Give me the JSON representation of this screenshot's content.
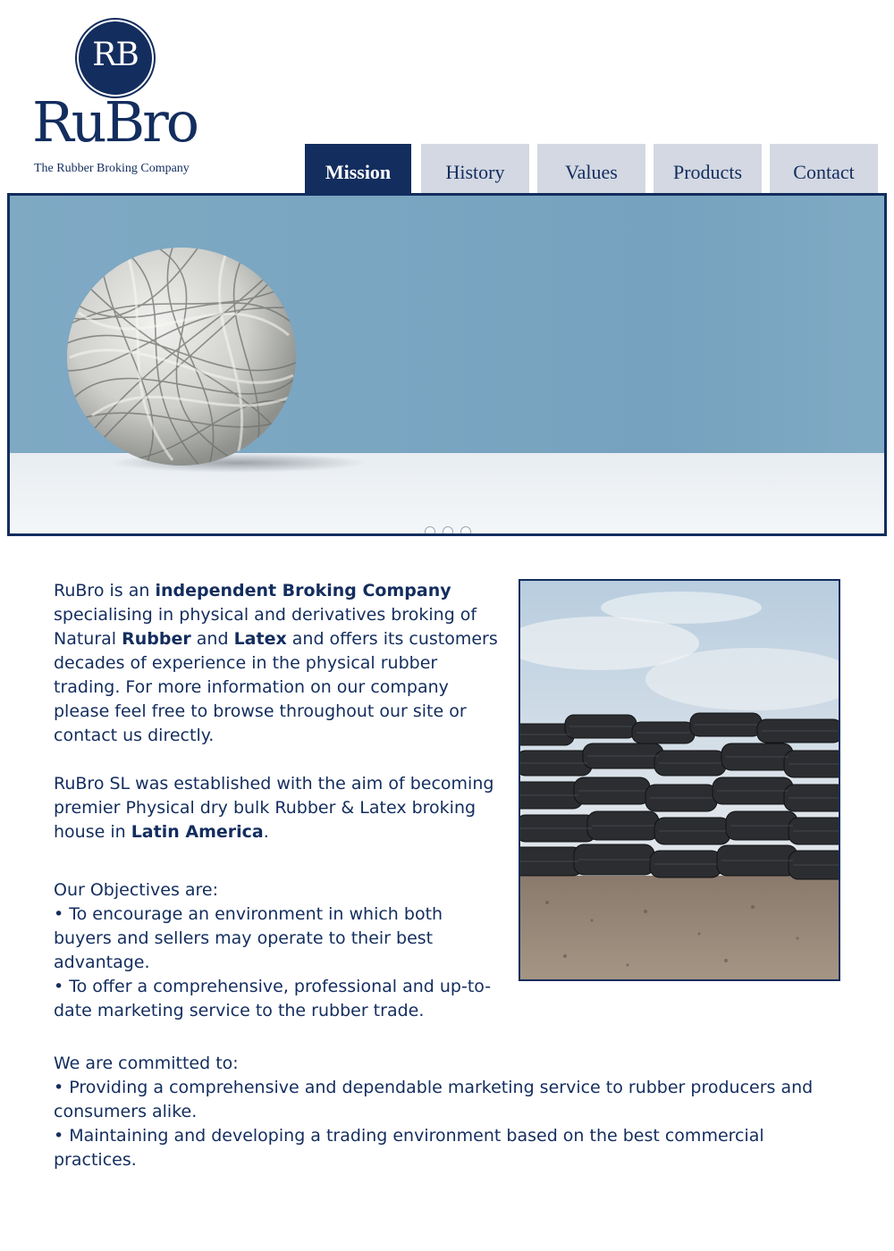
{
  "logo": {
    "monogram": "RB",
    "wordmark": "RuBro",
    "tagline": "The Rubber Broking Company"
  },
  "nav": {
    "tabs": [
      {
        "label": "Mission",
        "active": true
      },
      {
        "label": "History",
        "active": false
      },
      {
        "label": "Values",
        "active": false
      },
      {
        "label": "Products",
        "active": false
      },
      {
        "label": "Contact",
        "active": false
      }
    ]
  },
  "banner": {
    "image": "rubber-band-ball",
    "slide_count": 3
  },
  "side_image": "stacked-tyres",
  "intro": {
    "t1": "RuBro is an ",
    "b1": "independent Broking Company",
    "t2": " specialising in physical and derivatives broking of Natural ",
    "b2": "Rubber",
    "t3": " and ",
    "b3": "Latex",
    "t4": " and offers its customers decades of experience in the physical rubber trading. For more information on our company please feel free to browse throughout our site or contact us directly."
  },
  "established": {
    "t1": "RuBro SL was established with the aim of becoming premier Physical dry bulk Rubber & Latex broking house in ",
    "b1": "Latin America",
    "t2": "."
  },
  "objectives": {
    "heading": "Our Objectives are:",
    "items": [
      "•    To encourage an environment in which both buyers and sellers may operate to their best advantage.",
      "•    To offer a comprehensive, professional and up-to-date marketing service to the rubber trade."
    ]
  },
  "commitments": {
    "heading": "We are committed to:",
    "items": [
      "•    Providing a comprehensive and dependable marketing service to rubber producers and consumers alike.",
      "•    Maintaining and developing a trading environment based on the best commercial practices."
    ]
  },
  "colors": {
    "brand": "#132d5e",
    "tab_inactive": "#d3d8e2"
  }
}
